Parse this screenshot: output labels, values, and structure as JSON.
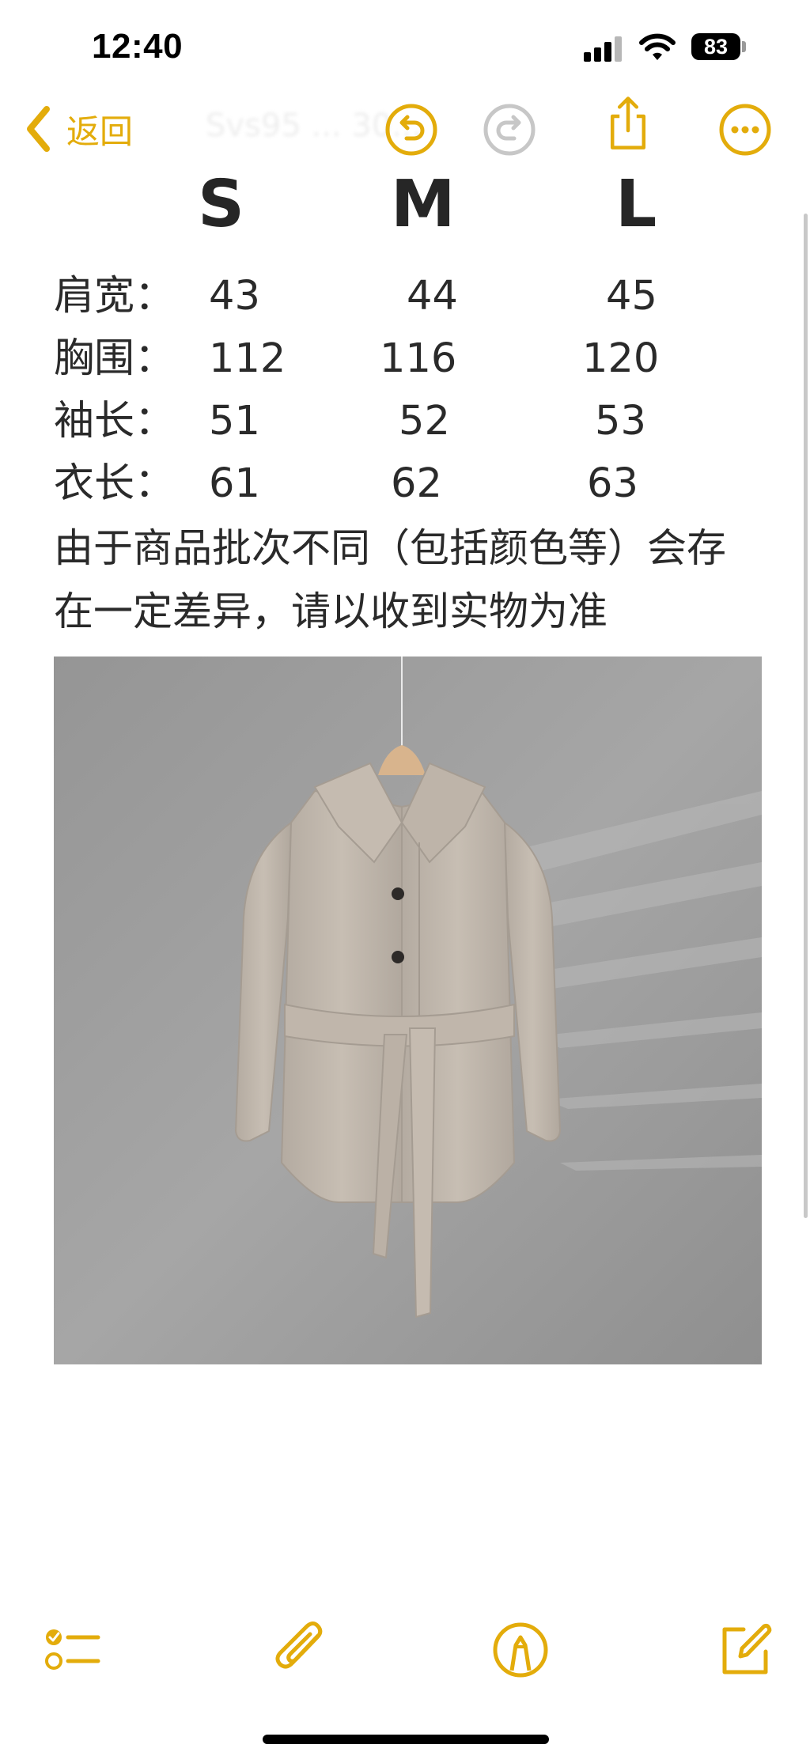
{
  "status_bar": {
    "time": "12:40",
    "battery": "83"
  },
  "nav": {
    "back_label": "返回",
    "ghost_title": "Svs95 ... 30...",
    "icons": [
      "chevron-left-icon",
      "undo-icon",
      "redo-icon",
      "share-icon",
      "more-icon"
    ],
    "accent_color": "#e3ac0b",
    "disabled_color": "#c7c7c7"
  },
  "note": {
    "sizes": [
      "S",
      "M",
      "L"
    ],
    "rows": [
      {
        "label": "肩宽：",
        "values": [
          "43",
          "44",
          "45"
        ]
      },
      {
        "label": "胸围：",
        "values": [
          "112",
          "116",
          "120"
        ]
      },
      {
        "label": "袖长：",
        "values": [
          "51",
          "52",
          "53"
        ]
      },
      {
        "label": "衣长：",
        "values": [
          "61",
          "62",
          "63"
        ]
      }
    ],
    "disclaimer": [
      "由于商品批次不同（包括颜色等）会存",
      "在一定差异，请以收到实物为准"
    ],
    "photo": "coat-photo"
  },
  "toolbar": {
    "icons": [
      "checklist-icon",
      "paperclip-icon",
      "markup-pen-icon",
      "compose-icon"
    ]
  }
}
